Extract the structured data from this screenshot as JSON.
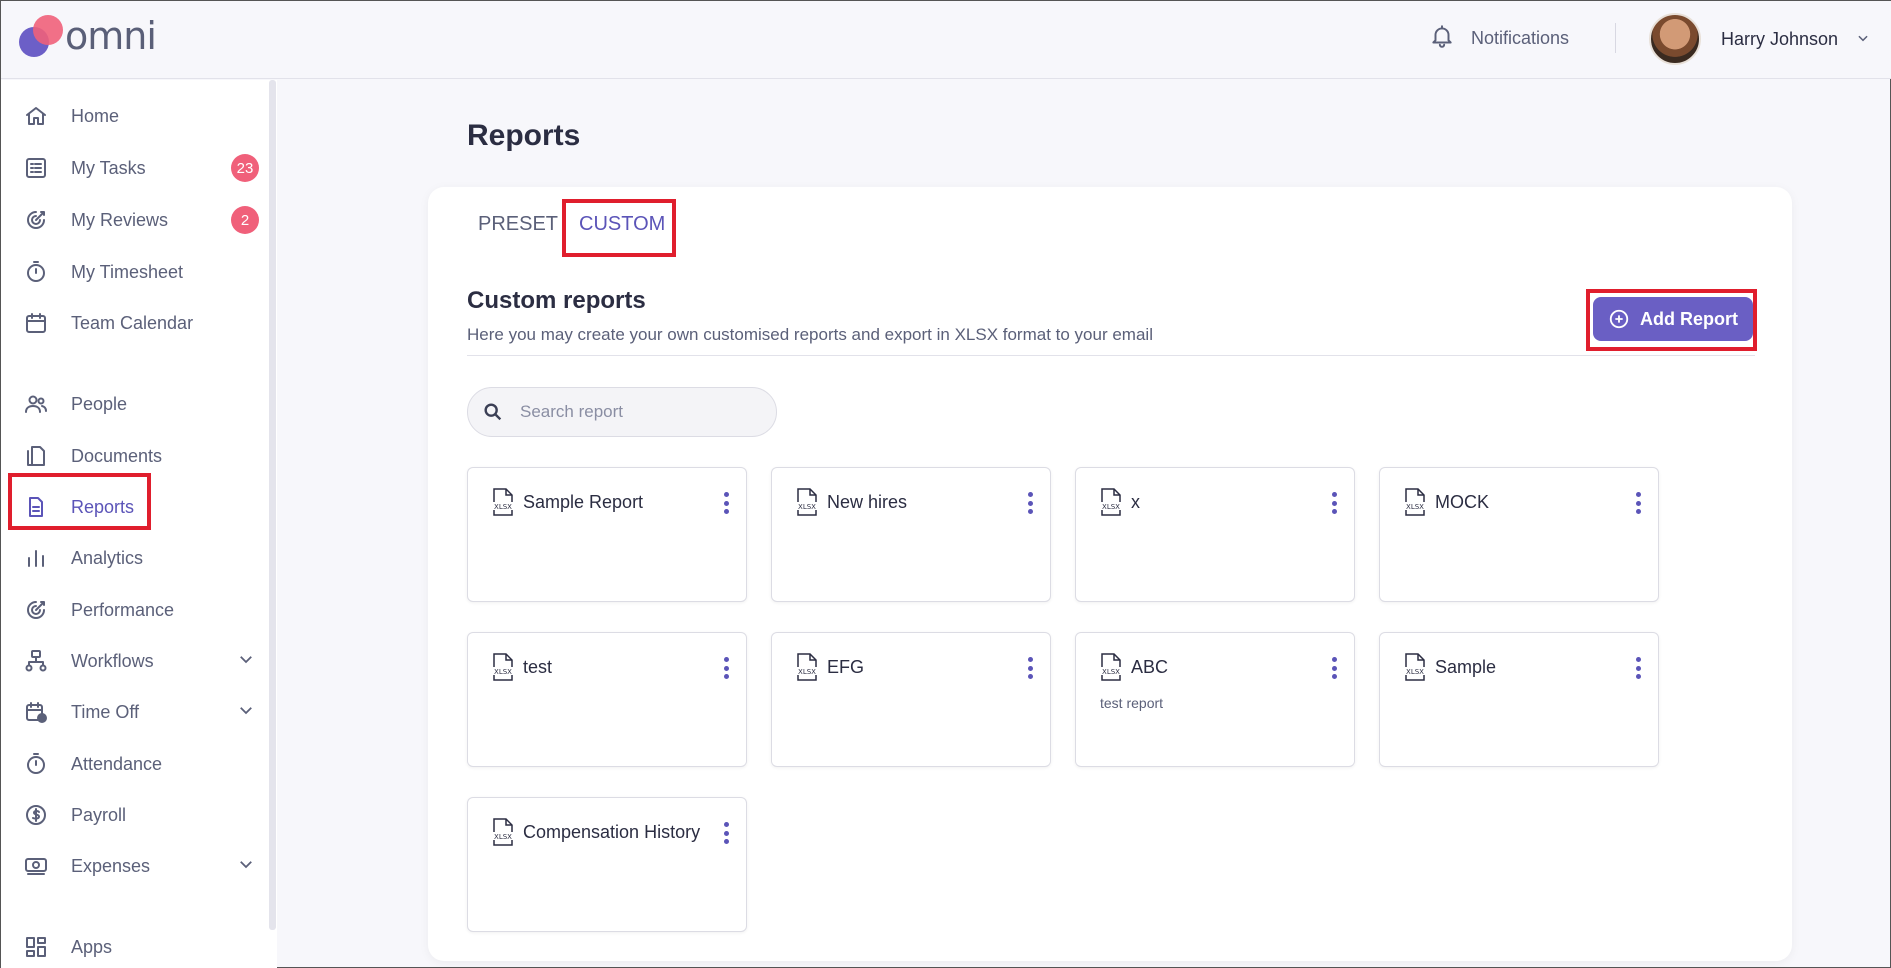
{
  "brand": {
    "name": "omni"
  },
  "header": {
    "notifications_label": "Notifications",
    "user_name": "Harry Johnson"
  },
  "sidebar": {
    "items": [
      {
        "label": "Home",
        "icon": "home-icon"
      },
      {
        "label": "My Tasks",
        "icon": "tasks-icon",
        "badge": "23"
      },
      {
        "label": "My Reviews",
        "icon": "reviews-icon",
        "badge": "2"
      },
      {
        "label": "My Timesheet",
        "icon": "stopwatch-icon"
      },
      {
        "label": "Team Calendar",
        "icon": "calendar-icon"
      },
      {
        "label": "People",
        "icon": "people-icon"
      },
      {
        "label": "Documents",
        "icon": "documents-icon"
      },
      {
        "label": "Reports",
        "icon": "report-icon",
        "active": true
      },
      {
        "label": "Analytics",
        "icon": "bar-chart-icon"
      },
      {
        "label": "Performance",
        "icon": "performance-icon"
      },
      {
        "label": "Workflows",
        "icon": "workflow-icon",
        "expandable": true
      },
      {
        "label": "Time Off",
        "icon": "calendar-clock-icon",
        "expandable": true
      },
      {
        "label": "Attendance",
        "icon": "stopwatch-icon"
      },
      {
        "label": "Payroll",
        "icon": "dollar-icon"
      },
      {
        "label": "Expenses",
        "icon": "money-icon",
        "expandable": true
      },
      {
        "label": "Apps",
        "icon": "apps-icon"
      }
    ]
  },
  "main": {
    "title": "Reports",
    "tabs": [
      {
        "label": "PRESET"
      },
      {
        "label": "CUSTOM",
        "active": true
      }
    ],
    "section_title": "Custom reports",
    "section_desc": "Here you may create your own customised reports and export in XLSX format to your email",
    "add_button_label": "Add Report",
    "search_placeholder": "Search report",
    "file_icon_label": "XLSX",
    "reports": [
      {
        "name": "Sample Report",
        "desc": ""
      },
      {
        "name": "New hires",
        "desc": ""
      },
      {
        "name": "x",
        "desc": ""
      },
      {
        "name": "MOCK",
        "desc": ""
      },
      {
        "name": "test",
        "desc": ""
      },
      {
        "name": "EFG",
        "desc": ""
      },
      {
        "name": "ABC",
        "desc": "test report"
      },
      {
        "name": "Sample",
        "desc": ""
      },
      {
        "name": "Compensation History",
        "desc": ""
      }
    ]
  },
  "colors": {
    "accent": "#5b54b8",
    "button": "#6a5fc4",
    "badge": "#f0607a",
    "highlight_box": "#e01e2d"
  }
}
